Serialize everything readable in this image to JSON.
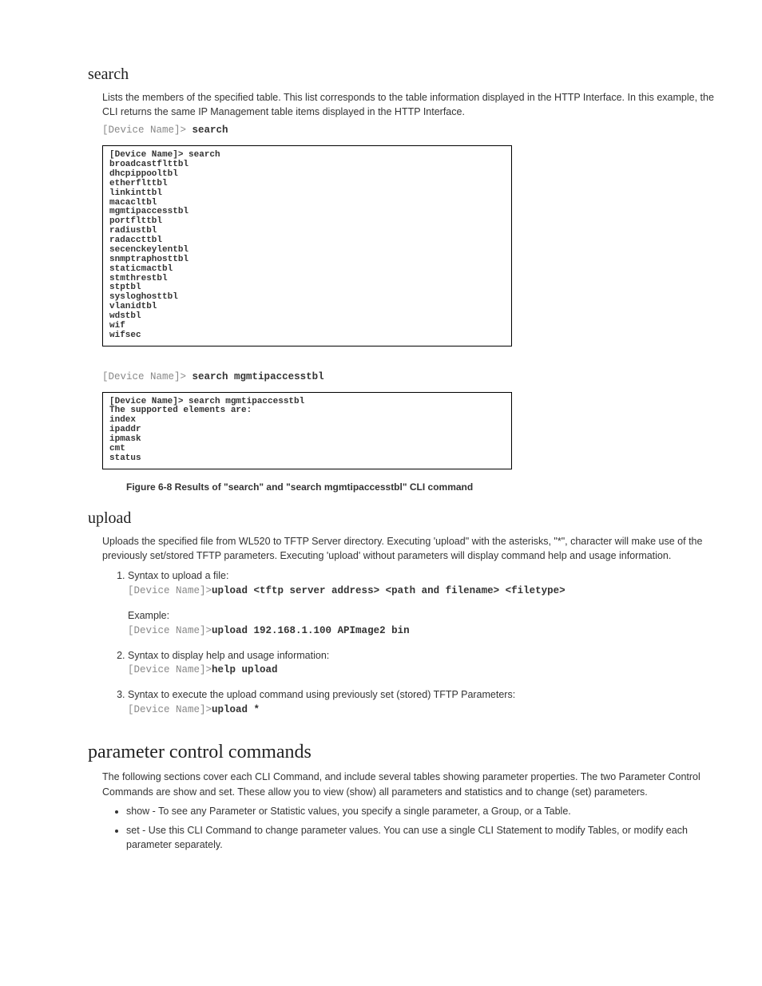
{
  "search": {
    "heading": "search",
    "intro": "Lists the members of the specified table. This list corresponds to the table information displayed in the HTTP Interface. In this example, the CLI returns the same IP Management table items displayed in the HTTP Interface.",
    "cmd1": {
      "prompt": "[Device Name]>",
      "cmd": "search"
    },
    "term1": "[Device Name]> search\nbroadcastflttbl\ndhcpippooltbl\netherflttbl\nlinkinttbl\nmacacltbl\nmgmtipaccesstbl\nportflttbl\nradiustbl\nradaccttbl\nsecenckeylentbl\nsnmptraphosttbl\nstaticmactbl\nstmthrestbl\nstptbl\nsysloghosttbl\nvlanidtbl\nwdstbl\nwif\nwifsec",
    "cmd2": {
      "prompt": "[Device Name]>",
      "cmd": "search mgmtipaccesstbl"
    },
    "term2": "[Device Name]> search mgmtipaccesstbl\nThe supported elements are:\nindex\nipaddr\nipmask\ncmt\nstatus",
    "caption": "Figure 6-8      Results of \"search\" and \"search mgmtipaccesstbl\" CLI command"
  },
  "upload": {
    "heading": "upload",
    "intro": "Uploads the specified file from WL520 to TFTP Server directory. Executing 'upload\" with the asterisks, \"*\", character will make use of the previously set/stored TFTP parameters. Executing 'upload' without parameters will display command help and usage information.",
    "items": [
      {
        "label": "Syntax to upload a file:",
        "prompt": "[Device Name]>",
        "cmd": "upload <tftp server address> <path and filename> <filetype>",
        "exLabel": "Example:",
        "exPrompt": "[Device Name]>",
        "exCmd": "upload 192.168.1.100 APImage2 bin"
      },
      {
        "label": "Syntax to display help and usage information:",
        "prompt": "[Device Name]>",
        "cmd": "help upload"
      },
      {
        "label": "Syntax to execute the upload command using previously set (stored) TFTP Parameters:",
        "prompt": "[Device Name]>",
        "cmd": "upload *"
      }
    ]
  },
  "pcc": {
    "heading": "parameter control commands",
    "intro": "The following sections cover each CLI Command, and include several tables showing parameter properties. The two Parameter Control Commands are show and set. These allow you to view (show) all parameters and statistics and to change (set) parameters.",
    "bullets": [
      "show - To see any Parameter or Statistic values, you specify a single parameter, a Group, or a Table.",
      "set - Use this CLI Command to change parameter values. You can use a single CLI Statement to modify Tables, or modify each parameter separately."
    ]
  }
}
